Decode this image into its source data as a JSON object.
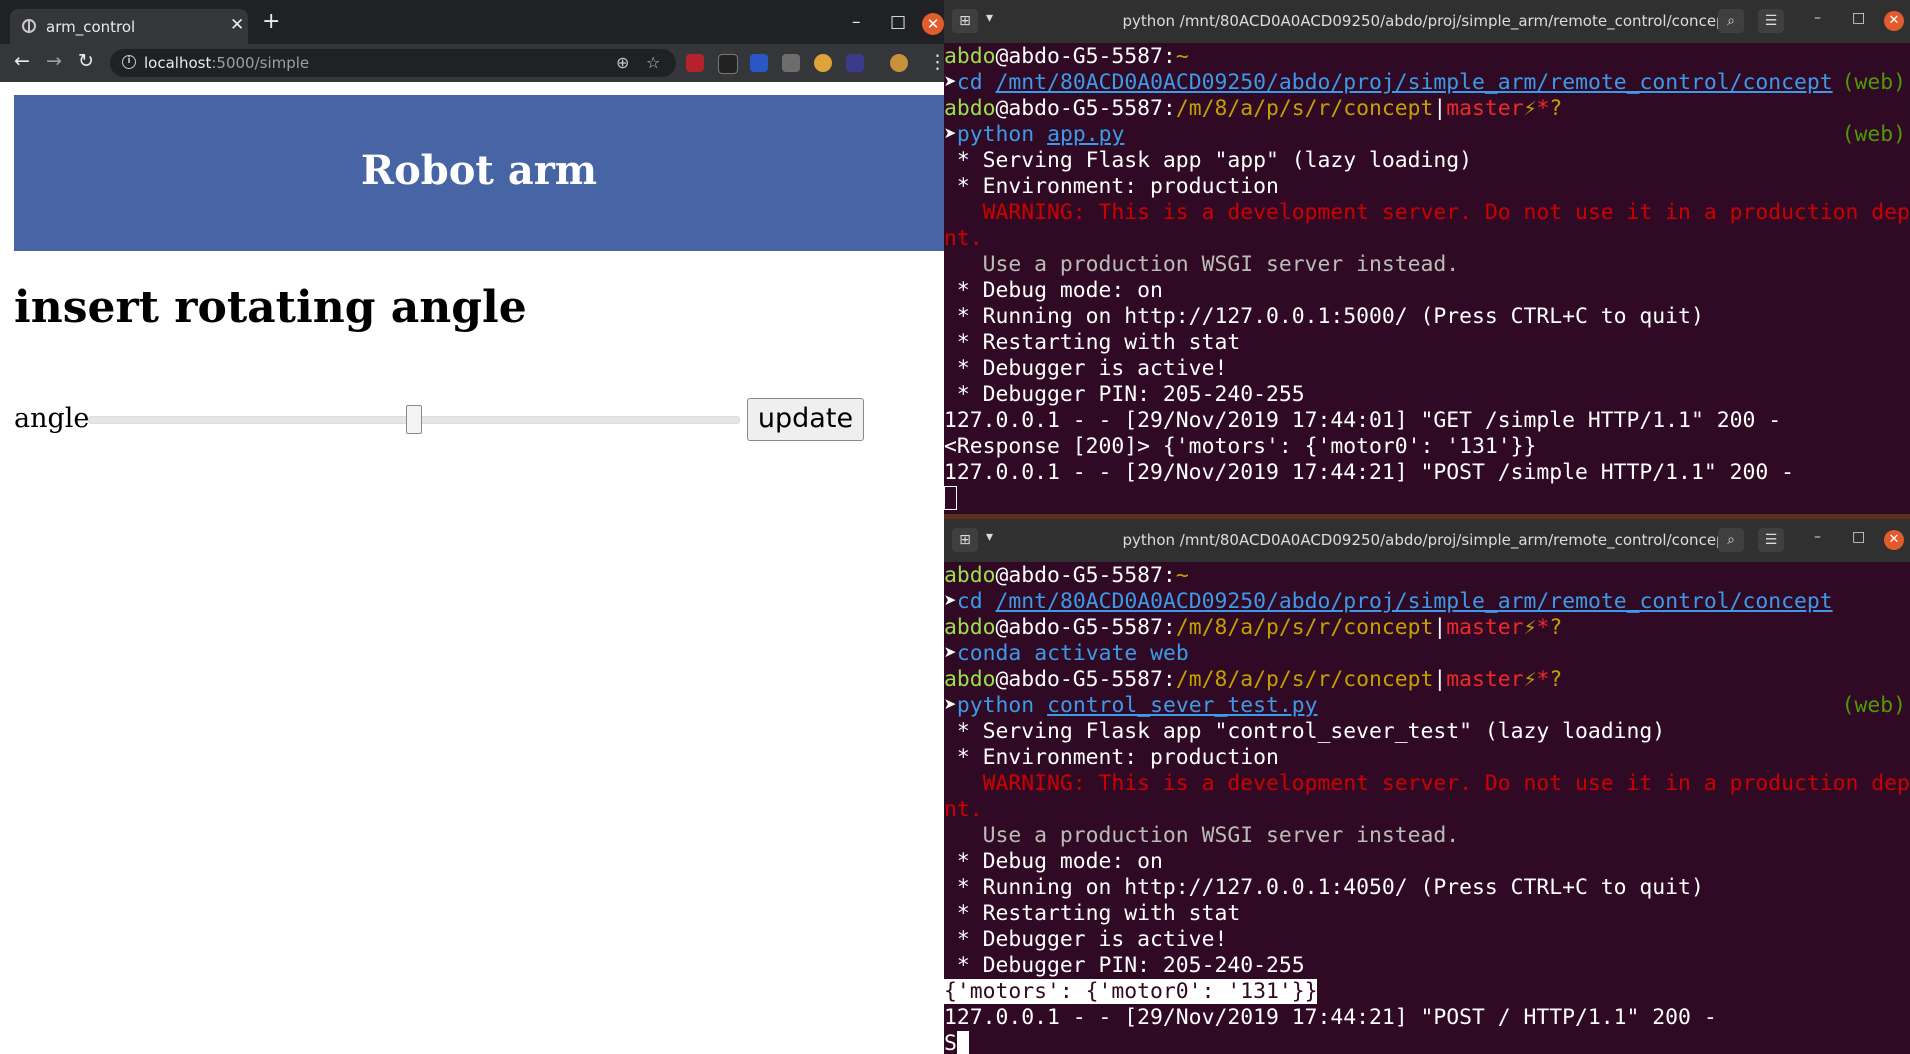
{
  "browser": {
    "tab_title": "arm_control",
    "url_host": "localhost",
    "url_path": ":5000/simple",
    "page": {
      "banner_title": "Robot arm",
      "heading": "insert rotating angle",
      "angle_label": "angle",
      "slider_value": 0.5,
      "update_label": "update"
    }
  },
  "terminal_top": {
    "title": "python /mnt/80ACD0A0ACD09250/abdo/proj/simple_arm/remote_control/concept",
    "user": "abdo",
    "host": "@abdo-G5-5587:",
    "home": "~",
    "cmd1": "cd",
    "cmd1_arg": "/mnt/80ACD0A0ACD09250/abdo/proj/simple_arm/remote_control/concept",
    "env": "(web)",
    "path_short": "/m/8/a/p/s/r/concept",
    "sep": "|",
    "branch": "master",
    "bolt": "⚡",
    "star": "*",
    "q": "?",
    "cmd2": "python",
    "cmd2_arg": "app.py",
    "out1": " * Serving Flask app \"app\" (lazy loading)",
    "out2": " * Environment: production",
    "warn1": "   WARNING: This is a development server. Do not use it in a production deployme",
    "warn2": "nt.",
    "out3": "   Use a production WSGI server instead.",
    "out4": " * Debug mode: on",
    "out5": " * Running on http://127.0.0.1:5000/ (Press CTRL+C to quit)",
    "out6": " * Restarting with stat",
    "out7": " * Debugger is active!",
    "out8": " * Debugger PIN: 205-240-255",
    "log1": "127.0.0.1 - - [29/Nov/2019 17:44:01] \"GET /simple HTTP/1.1\" 200 -",
    "log2": "<Response [200]> {'motors': {'motor0': '131'}}",
    "log3": "127.0.0.1 - - [29/Nov/2019 17:44:21] \"POST /simple HTTP/1.1\" 200 -"
  },
  "terminal_bottom": {
    "title": "python /mnt/80ACD0A0ACD09250/abdo/proj/simple_arm/remote_control/concept",
    "user": "abdo",
    "host": "@abdo-G5-5587:",
    "home": "~",
    "cmd1": "cd",
    "cmd1_arg": "/mnt/80ACD0A0ACD09250/abdo/proj/simple_arm/remote_control/concept",
    "path_short": "/m/8/a/p/s/r/concept",
    "sep": "|",
    "branch": "master",
    "bolt": "⚡",
    "star": "*",
    "q": "?",
    "cmd2": "conda",
    "cmd2_arg": "activate web",
    "cmd3": "python",
    "cmd3_arg": "control_sever_test.py",
    "env": "(web)",
    "out1": " * Serving Flask app \"control_sever_test\" (lazy loading)",
    "out2": " * Environment: production",
    "warn1": "   WARNING: This is a development server. Do not use it in a production deployme",
    "warn2": "nt.",
    "out3": "   Use a production WSGI server instead.",
    "out4": " * Debug mode: on",
    "out5": " * Running on http://127.0.0.1:4050/ (Press CTRL+C to quit)",
    "out6": " * Restarting with stat",
    "out7": " * Debugger is active!",
    "out8": " * Debugger PIN: 205-240-255",
    "payload": "{'motors': {'motor0': '131'}}",
    "log1": "127.0.0.1 - - [29/Nov/2019 17:44:21] \"POST / HTTP/1.1\" 200 -",
    "last": "S"
  },
  "prompt_arrow": "➤",
  "icons": {
    "close": "✕",
    "plus": "+",
    "minimize": "–",
    "maximize": "□",
    "back": "←",
    "forward": "→",
    "reload": "↻",
    "zoom": "⊕",
    "star": "☆",
    "dots": "⋮",
    "search": "⌕",
    "hamburger": "☰",
    "newtab": "⊞",
    "dropdown": "▾"
  }
}
